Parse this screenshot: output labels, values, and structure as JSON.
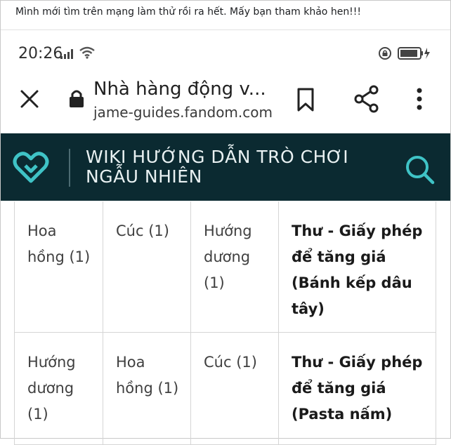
{
  "caption": "Mình mới tìm trên mạng làm thử rồi ra hết. Mấy bạn tham khảo hen!!!",
  "status_bar": {
    "time": "20:26"
  },
  "browser": {
    "title": "Nhà hàng động v...",
    "url": "jame-guides.fandom.com"
  },
  "wiki": {
    "title_line1": "WIKI HƯỚNG DẪN TRÒ CHƠI",
    "title_line2": "NGẪU NHIÊN",
    "colors": {
      "header_bg": "#0b2a31",
      "accent": "#3fc3c6"
    }
  },
  "table": {
    "rows": [
      [
        "Hoa hồng (1)",
        "Cúc (1)",
        "Hướng dương (1)",
        "Thư - Giấy phép để tăng giá (Bánh kếp dâu tây)"
      ],
      [
        "Hướng dương (1)",
        "Hoa hồng (1)",
        "Cúc (1)",
        "Thư - Giấy phép để tăng giá (Pasta nấm)"
      ]
    ]
  },
  "icons": {
    "close": "close-icon",
    "lock": "padlock-icon",
    "bookmark": "bookmark-icon",
    "share": "share-icon",
    "more": "more-vertical-icon",
    "search": "search-icon",
    "logo": "fandom-heart-logo"
  }
}
